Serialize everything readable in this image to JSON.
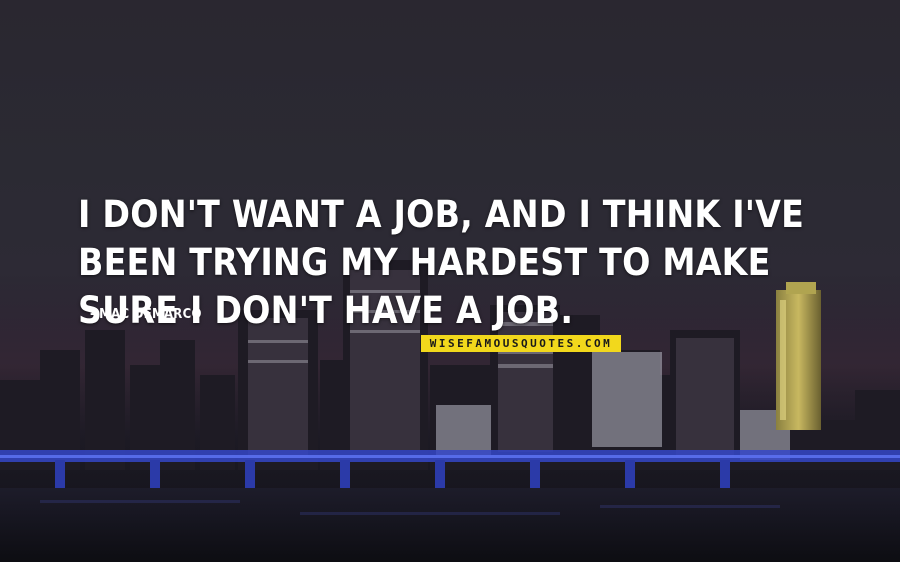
{
  "quote": {
    "text": "I DON'T WANT A JOB, AND I THINK I'VE BEEN TRYING MY HARDEST TO MAKE SURE I DON'T HAVE A JOB.",
    "author": "MAC DEMARCO",
    "author_prefix": "-"
  },
  "watermark": {
    "text": "WISEFAMOUSQUOTES.COM"
  },
  "colors": {
    "quote_text": "#ffffff",
    "watermark_bg": "#f2d81c",
    "skyline_dark": "#1a1820",
    "bridge_blue": "#3b4fd8"
  }
}
